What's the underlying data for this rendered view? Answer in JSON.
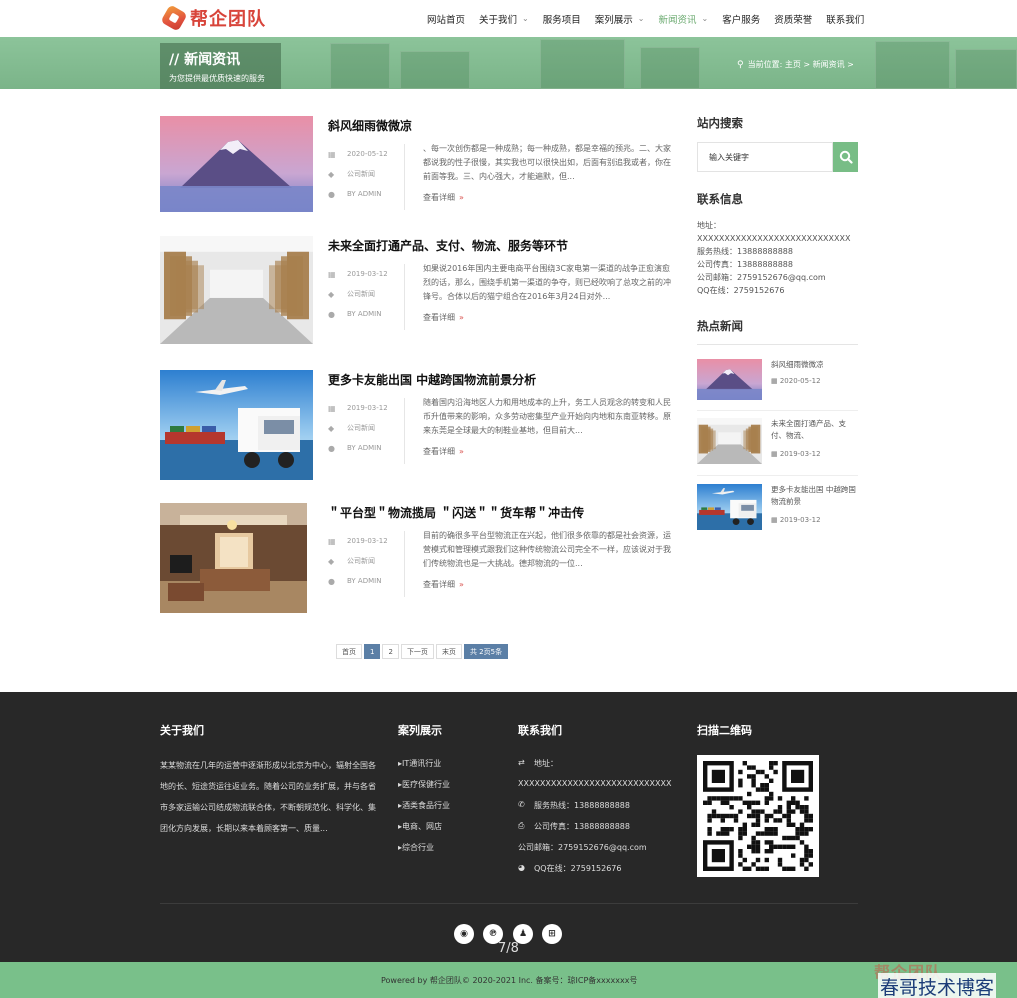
{
  "header": {
    "logo_text": "帮企团队",
    "nav": [
      {
        "label": "网站首页",
        "caret": ""
      },
      {
        "label": "关于我们",
        "caret": "⌄"
      },
      {
        "label": "服务项目",
        "caret": ""
      },
      {
        "label": "案列展示",
        "caret": "⌄"
      },
      {
        "label": "新闻资讯",
        "caret": "⌄"
      },
      {
        "label": "客户服务",
        "caret": ""
      },
      {
        "label": "资质荣誉",
        "caret": ""
      },
      {
        "label": "联系我们",
        "caret": ""
      }
    ],
    "active_nav": "新闻资讯"
  },
  "banner": {
    "title": "// 新闻资讯",
    "subtitle": "为您提供最优质快速的服务",
    "breadcrumb": "当前位置: 主页 > 新闻资讯 >"
  },
  "articles": [
    {
      "title": "斜风细雨微微凉",
      "date": "2020-05-12",
      "category": "公司新闻",
      "author": "BY ADMIN",
      "excerpt": "、每一次创伤都是一种成熟；每一种成熟，都是幸福的预兆。二、大家都说我的性子很慢，其实我也可以很快出如，后面有别追我或者，你在前面等我。三、内心强大，才能遍默，但...",
      "more": "查看详细",
      "image": "mountain"
    },
    {
      "title": "未来全面打通产品、支付、物流、服务等环节",
      "date": "2019-03-12",
      "category": "公司新闻",
      "author": "BY ADMIN",
      "excerpt": "如果说2016年国内主要电商平台围绕3C家电第一渠道的战争正愈演愈烈的话，那么，围绕手机第一渠道的争夺，则已经吹响了总攻之前的冲锋号。合体以后的猫宁组合在2016年3月24日对外...",
      "more": "查看详细",
      "image": "warehouse"
    },
    {
      "title": "更多卡友能出国 中越跨国物流前景分析",
      "date": "2019-03-12",
      "category": "公司新闻",
      "author": "BY ADMIN",
      "excerpt": "随着国内沿海地区人力和用地成本的上升，务工人员观念的转变和人民币升值带来的影响，众多劳动密集型产业开始向内地和东南亚转移。原来东莞是全球最大的制鞋业基地，但目前大...",
      "more": "查看详细",
      "image": "logistics"
    },
    {
      "title": "＂平台型＂物流揽局 ＂闪送＂＂货车帮＂冲击传",
      "date": "2019-03-12",
      "category": "公司新闻",
      "author": "BY ADMIN",
      "excerpt": "目前的确很多平台型物流正在兴起，他们很多依靠的都是社会资源，运营模式和管理模式跟我们这种传统物流公司完全不一样，应该说对于我们传统物流也是一大挑战。德邦物流的一位...",
      "more": "查看详细",
      "image": "room"
    }
  ],
  "pagination": {
    "items": [
      "首页",
      "1",
      "2",
      "下一页",
      "末页"
    ],
    "current": "1",
    "info": "共 2页5条"
  },
  "sidebar": {
    "search_title": "站内搜索",
    "search_placeholder": "输入关键字",
    "contact_title": "联系信息",
    "contact_lines": [
      "地址：",
      "XXXXXXXXXXXXXXXXXXXXXXXXXXXX",
      "服务热线：13888888888",
      "公司传真：13888888888",
      "公司邮箱：2759152676@qq.com",
      "QQ在线：2759152676"
    ],
    "hot_title": "热点新闻",
    "hot_news": [
      {
        "title": "斜风细雨微微凉",
        "date": "2020-05-12",
        "image": "mountain"
      },
      {
        "title": "未来全面打通产品、支付、物流、",
        "date": "2019-03-12",
        "image": "warehouse"
      },
      {
        "title": "更多卡友能出国 中越跨国物流前景",
        "date": "2019-03-12",
        "image": "logistics"
      }
    ]
  },
  "footer": {
    "about_title": "关于我们",
    "about_text": "某某物流在几年的运营中逐渐形成以北京为中心，辐射全国各地的长、短途货运往返业务。随着公司的业务扩展，并与各省市多家运输公司结成物流联合体，不断朝规范化、科学化、集团化方向发展，长期以来本着顾客第一、质量...",
    "cases_title": "案列展示",
    "cases": [
      "IT通讯行业",
      "医疗保健行业",
      "酒类食品行业",
      "电商、网店",
      "综合行业"
    ],
    "contact_title": "联系我们",
    "contact": [
      {
        "icon": "⇄",
        "text": "地址："
      },
      {
        "icon": "",
        "text": "XXXXXXXXXXXXXXXXXXXXXXXXXXXX"
      },
      {
        "icon": "✆",
        "text": "服务热线：13888888888"
      },
      {
        "icon": "⎙",
        "text": "公司传真：13888888888"
      },
      {
        "icon": "",
        "text": "公司邮箱：2759152676@qq.com"
      },
      {
        "icon": "◕",
        "text": "QQ在线：2759152676"
      }
    ],
    "qr_title": "扫描二维码",
    "social_icons": [
      "weibo-icon",
      "pinterest-icon",
      "qq-icon",
      "cart-icon"
    ],
    "page_indicator": "7/8",
    "copyright": "Powered by 帮企团队© 2020-2021 Inc. 备案号：琼ICP备xxxxxxx号",
    "watermark_text": "春哥技术博客",
    "watermark_logo": "帮企团队"
  },
  "colors": {
    "accent": "#78bd86",
    "nav_active": "#6aaa6f",
    "footer_bg": "#282828",
    "pager_active": "#5b7fa6",
    "link_arrow": "#d9534f"
  }
}
